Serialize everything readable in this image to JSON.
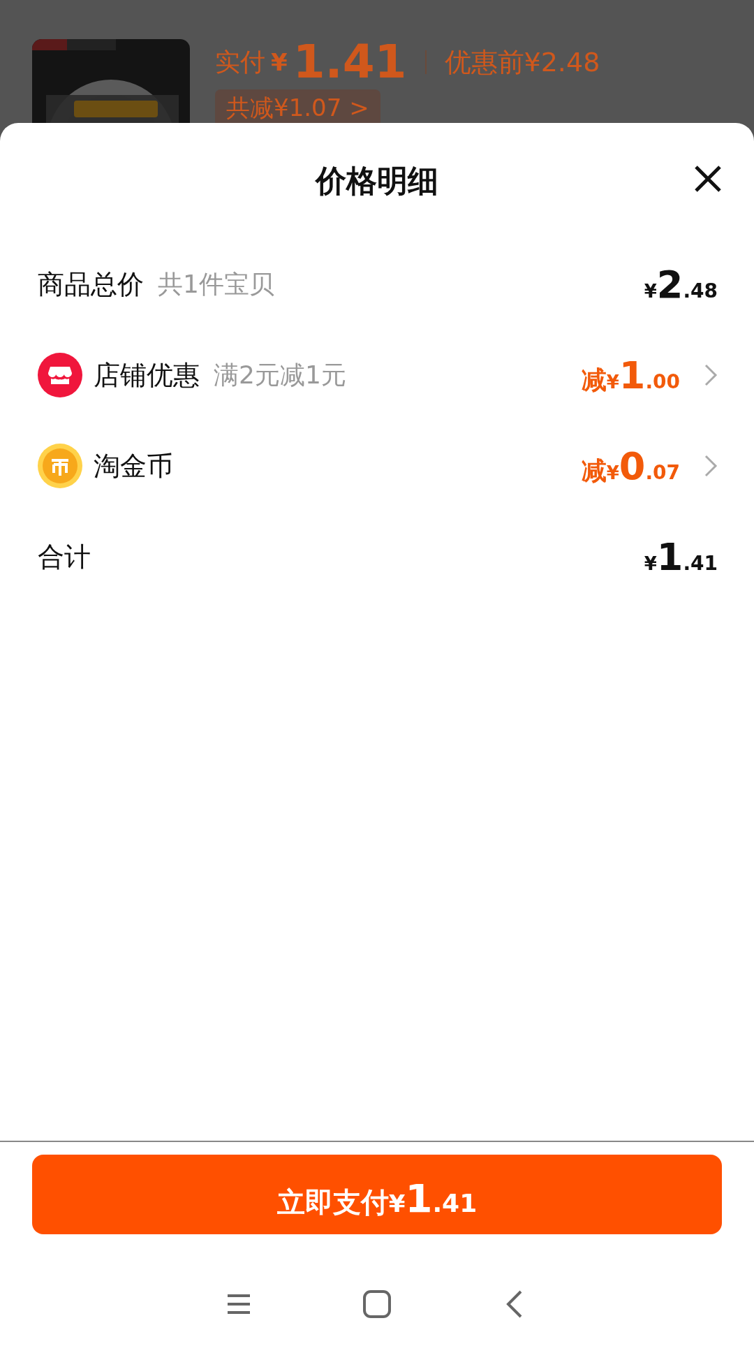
{
  "order_summary": {
    "paid_label": "实付",
    "paid_currency": "¥",
    "paid_amount": "1.41",
    "original_price": "优惠前¥2.48",
    "savings": "共减¥1.07 >"
  },
  "sheet": {
    "title": "价格明细",
    "rows": [
      {
        "kind": "total",
        "label": "商品总价",
        "note": "共1件宝贝",
        "prefix": "",
        "currency": "¥",
        "integer": "2",
        "decimal": ".48"
      },
      {
        "kind": "shop",
        "label": "店铺优惠",
        "note": "满2元减1元",
        "prefix": "减",
        "currency": "¥",
        "integer": "1",
        "decimal": ".00"
      },
      {
        "kind": "coin",
        "label": "淘金币",
        "note": "",
        "prefix": "减",
        "currency": "¥",
        "integer": "0",
        "decimal": ".07"
      },
      {
        "kind": "total",
        "label": "合计",
        "note": "",
        "prefix": "",
        "currency": "¥",
        "integer": "1",
        "decimal": ".41"
      }
    ]
  },
  "pay_button": {
    "label": "立即支付",
    "currency": "¥",
    "integer": "1",
    "decimal": ".41"
  }
}
